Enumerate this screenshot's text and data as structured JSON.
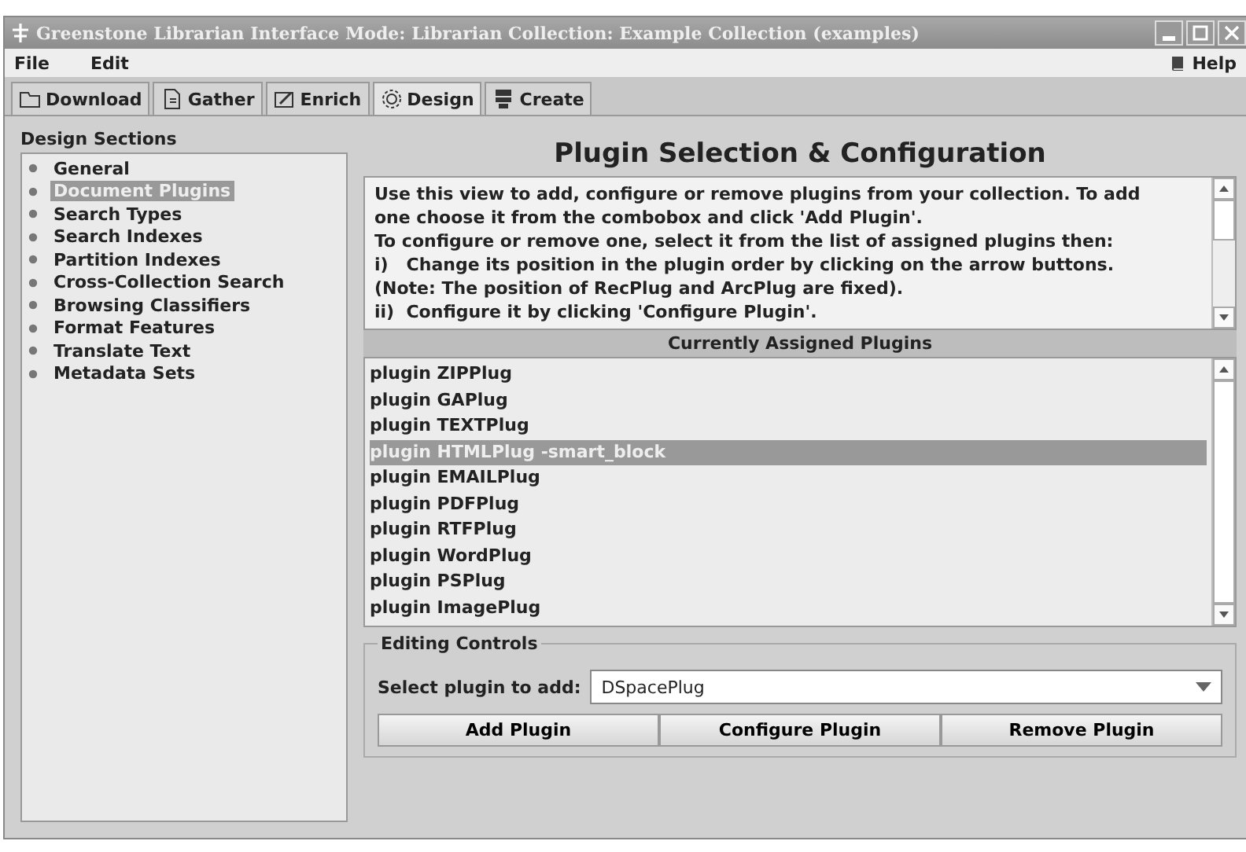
{
  "window": {
    "title": "Greenstone Librarian Interface  Mode: Librarian  Collection: Example Collection (examples)"
  },
  "menu": {
    "items": [
      "File",
      "Edit"
    ],
    "help": "Help"
  },
  "tabs": [
    {
      "label": "Download",
      "selected": false
    },
    {
      "label": "Gather",
      "selected": false
    },
    {
      "label": "Enrich",
      "selected": false
    },
    {
      "label": "Design",
      "selected": true
    },
    {
      "label": "Create",
      "selected": false
    }
  ],
  "sidebar": {
    "title": "Design Sections",
    "items": [
      {
        "label": "General",
        "selected": false
      },
      {
        "label": "Document Plugins",
        "selected": true
      },
      {
        "label": "Search Types",
        "selected": false
      },
      {
        "label": "Search Indexes",
        "selected": false
      },
      {
        "label": "Partition Indexes",
        "selected": false
      },
      {
        "label": "Cross-Collection Search",
        "selected": false
      },
      {
        "label": "Browsing Classifiers",
        "selected": false
      },
      {
        "label": "Format Features",
        "selected": false
      },
      {
        "label": "Translate Text",
        "selected": false
      },
      {
        "label": "Metadata Sets",
        "selected": false
      }
    ]
  },
  "main": {
    "title": "Plugin Selection & Configuration",
    "help_lines": [
      "Use this view to add, configure or remove plugins from your collection. To add",
      "one choose it from the combobox and click 'Add Plugin'.",
      "To configure or remove one, select it from the list of assigned plugins then:",
      "i)   Change its position in the plugin order by clicking on the arrow buttons.",
      "(Note: The position of RecPlug and ArcPlug are fixed).",
      "ii)  Configure it by clicking 'Configure Plugin'."
    ],
    "list_title": "Currently Assigned Plugins",
    "plugins": [
      {
        "label": "plugin ZIPPlug",
        "selected": false
      },
      {
        "label": "plugin GAPlug",
        "selected": false
      },
      {
        "label": "plugin TEXTPlug",
        "selected": false
      },
      {
        "label": "plugin HTMLPlug -smart_block",
        "selected": true
      },
      {
        "label": "plugin EMAILPlug",
        "selected": false
      },
      {
        "label": "plugin PDFPlug",
        "selected": false
      },
      {
        "label": "plugin RTFPlug",
        "selected": false
      },
      {
        "label": "plugin WordPlug",
        "selected": false
      },
      {
        "label": "plugin PSPlug",
        "selected": false
      },
      {
        "label": "plugin ImagePlug",
        "selected": false
      }
    ],
    "controls": {
      "title": "Editing Controls",
      "select_label": "Select plugin to add:",
      "select_value": "DSpacePlug",
      "buttons": [
        "Add Plugin",
        "Configure Plugin",
        "Remove Plugin"
      ]
    }
  }
}
